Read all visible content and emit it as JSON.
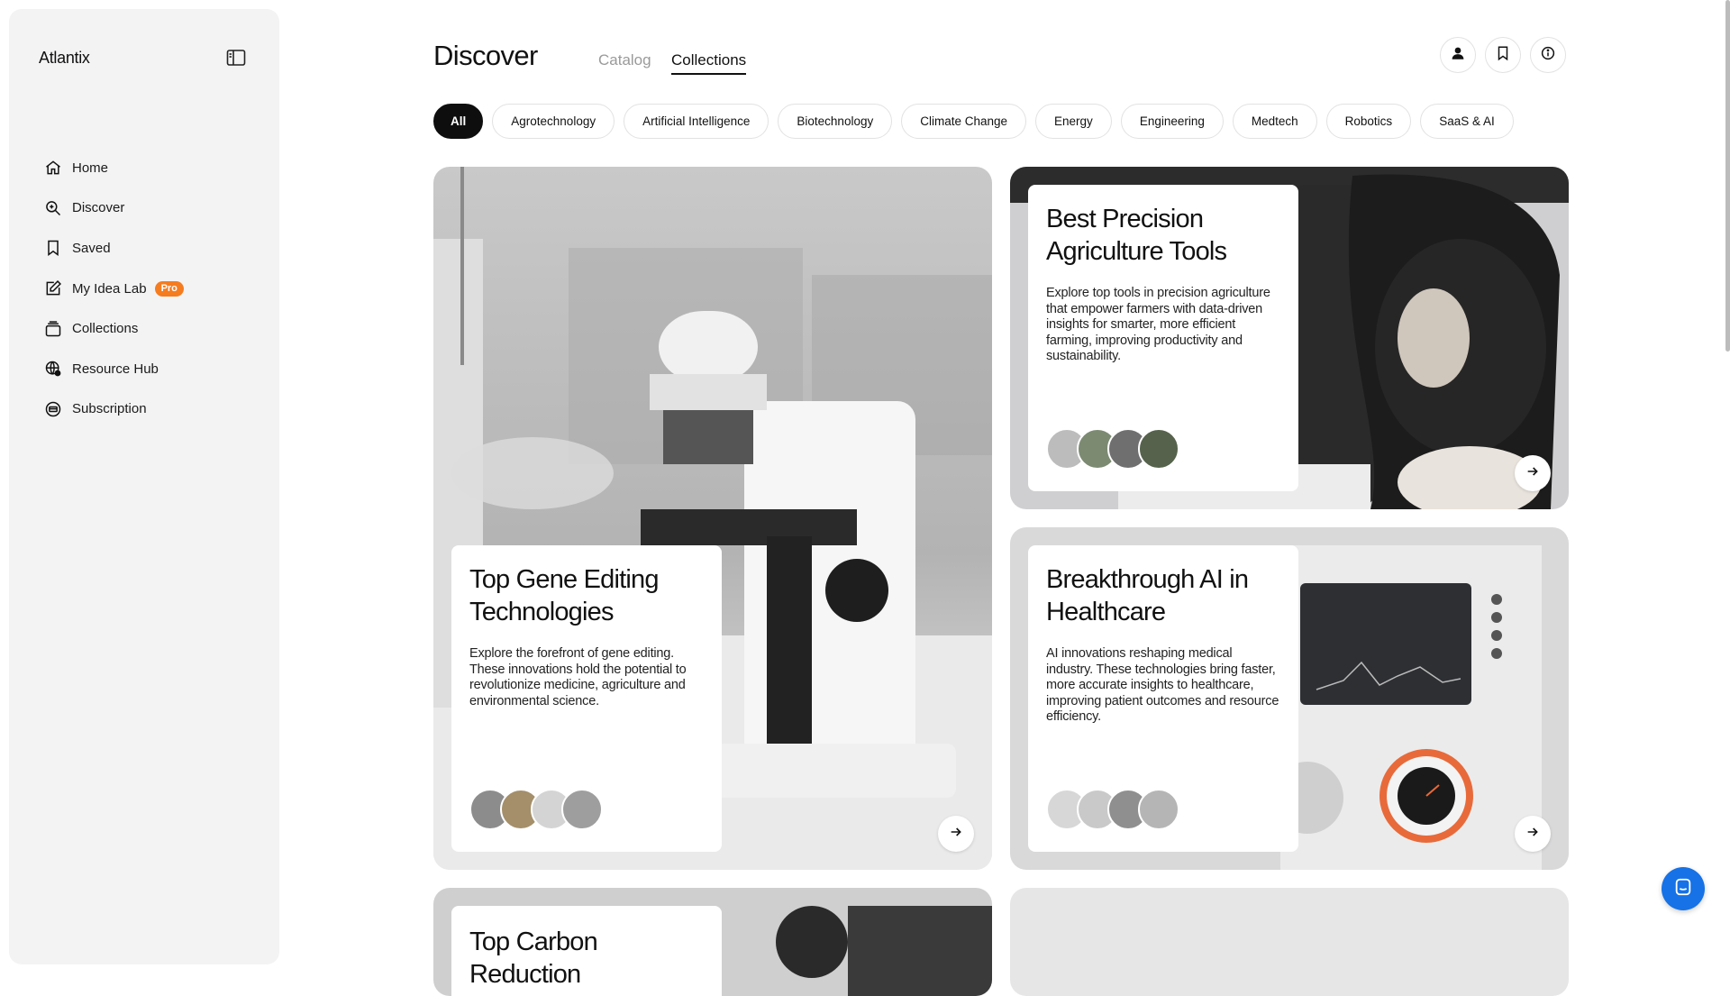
{
  "app": {
    "name": "Atlantix"
  },
  "sidebar": {
    "items": [
      {
        "label": "Home",
        "icon": "home-icon"
      },
      {
        "label": "Discover",
        "icon": "search-icon"
      },
      {
        "label": "Saved",
        "icon": "bookmark-icon"
      },
      {
        "label": "My Idea Lab",
        "icon": "edit-icon",
        "badge": "Pro"
      },
      {
        "label": "Collections",
        "icon": "collections-icon"
      },
      {
        "label": "Resource Hub",
        "icon": "globe-icon"
      },
      {
        "label": "Subscription",
        "icon": "subscription-icon"
      }
    ]
  },
  "header": {
    "title": "Discover",
    "tabs": [
      {
        "label": "Catalog",
        "active": false
      },
      {
        "label": "Collections",
        "active": true
      }
    ],
    "actions": [
      "user-icon",
      "bookmark-icon",
      "info-icon"
    ]
  },
  "filters": [
    "All",
    "Agrotechnology",
    "Artificial Intelligence",
    "Biotechnology",
    "Climate Change",
    "Energy",
    "Engineering",
    "Medtech",
    "Robotics",
    "SaaS & AI"
  ],
  "active_filter": "All",
  "cards": [
    {
      "title": "Top Gene Editing Technologies",
      "description": "Explore the forefront of gene editing. These innovations hold the potential to revolutionize medicine, agriculture and environmental science."
    },
    {
      "title": "Best Precision Agriculture Tools",
      "description": "Explore top tools in precision agriculture that empower farmers with data-driven insights for smarter, more efficient farming, improving productivity and sustainability."
    },
    {
      "title": "Breakthrough AI in Healthcare",
      "description": "AI innovations reshaping medical industry. These technologies bring faster, more accurate insights to healthcare, improving patient outcomes and resource efficiency."
    },
    {
      "title": "Top Carbon Reduction"
    }
  ],
  "colors": {
    "accent": "#f57c1f",
    "chat": "#1672e6",
    "active_chip": "#0e0e0e"
  }
}
